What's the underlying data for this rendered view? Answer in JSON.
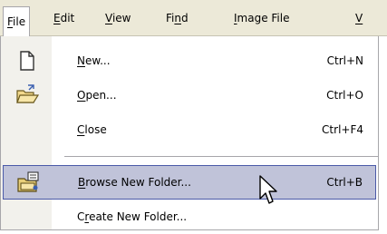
{
  "menubar": {
    "items": [
      {
        "prefix": "",
        "key": "F",
        "rest": "ile"
      },
      {
        "prefix": "",
        "key": "E",
        "rest": "dit"
      },
      {
        "prefix": "",
        "key": "V",
        "rest": "iew"
      },
      {
        "prefix": "Fi",
        "key": "n",
        "rest": "d"
      },
      {
        "prefix": "",
        "key": "I",
        "rest": "mage File"
      },
      {
        "prefix": "",
        "key": "V",
        "rest": ""
      }
    ]
  },
  "file_menu": {
    "items": [
      {
        "prefix": "",
        "key": "N",
        "rest": "ew...",
        "shortcut": "Ctrl+N",
        "icon": "new-document-icon"
      },
      {
        "prefix": "",
        "key": "O",
        "rest": "pen...",
        "shortcut": "Ctrl+O",
        "icon": "open-folder-icon"
      },
      {
        "prefix": "",
        "key": "C",
        "rest": "lose",
        "shortcut": "Ctrl+F4",
        "icon": ""
      },
      {
        "prefix": "",
        "key": "B",
        "rest": "rowse New Folder...",
        "shortcut": "Ctrl+B",
        "icon": "browse-folder-icon"
      },
      {
        "prefix": "C",
        "key": "r",
        "rest": "eate New Folder...",
        "shortcut": "",
        "icon": ""
      }
    ]
  },
  "colors": {
    "menubar_bg": "#ece9d8",
    "highlight_bg": "#c0c3d9",
    "highlight_border": "#4b5aa8",
    "gutter_bg": "#f2f1ec"
  }
}
